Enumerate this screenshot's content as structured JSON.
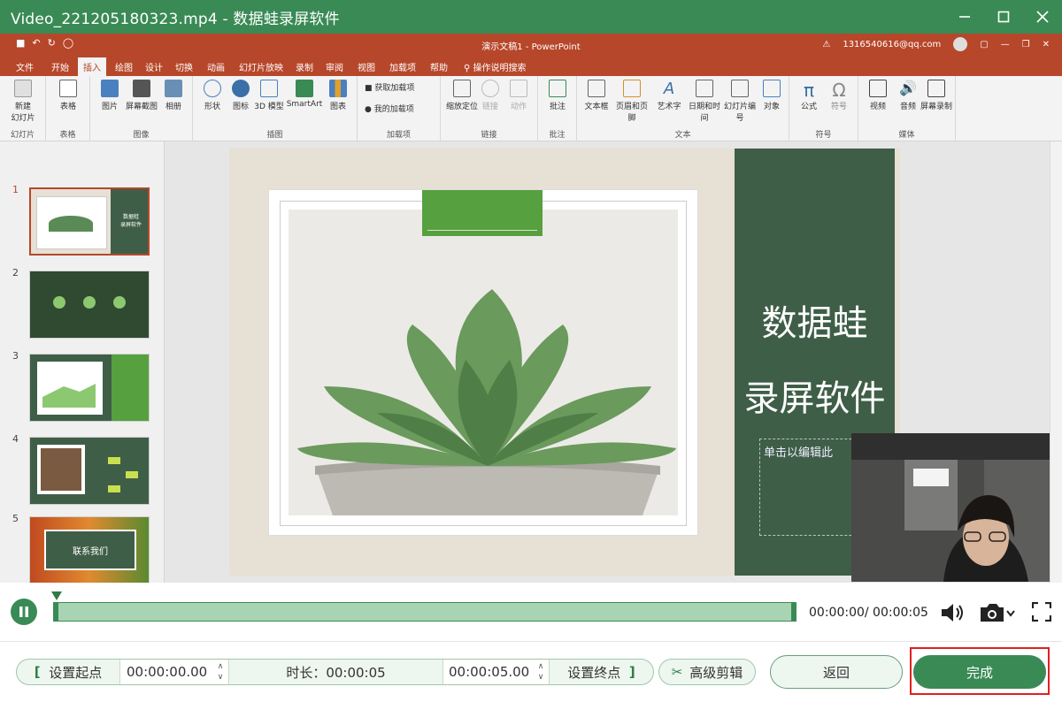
{
  "window": {
    "title": "Video_221205180323.mp4  -  数据蛙录屏软件"
  },
  "ppt": {
    "doc_title": "演示文稿1 - PowerPoint",
    "account": "1316540616@qq.com",
    "tabs": [
      "文件",
      "开始",
      "插入",
      "绘图",
      "设计",
      "切换",
      "动画",
      "幻灯片放映",
      "录制",
      "审阅",
      "视图",
      "加载项",
      "帮助",
      "操作说明搜索"
    ],
    "active_tab": "插入",
    "ribbon_groups": [
      {
        "label": "幻灯片",
        "buttons": [
          "新建\n幻灯片"
        ]
      },
      {
        "label": "表格",
        "buttons": [
          "表格"
        ]
      },
      {
        "label": "图像",
        "buttons": [
          "图片",
          "屏幕截图",
          "相册"
        ]
      },
      {
        "label": "插图",
        "buttons": [
          "形状",
          "图标",
          "3D 模型",
          "SmartArt",
          "图表"
        ]
      },
      {
        "label": "加载项",
        "buttons": [
          "获取加载项",
          "我的加载项"
        ]
      },
      {
        "label": "链接",
        "buttons": [
          "缩放定位",
          "链接",
          "动作"
        ]
      },
      {
        "label": "批注",
        "buttons": [
          "批注"
        ]
      },
      {
        "label": "文本",
        "buttons": [
          "文本框",
          "页眉和页脚",
          "艺术字",
          "日期和时间",
          "幻灯片编号",
          "对象"
        ]
      },
      {
        "label": "符号",
        "buttons": [
          "公式",
          "符号"
        ]
      },
      {
        "label": "媒体",
        "buttons": [
          "视频",
          "音频",
          "屏幕录制"
        ]
      }
    ],
    "slide_numbers": [
      "1",
      "2",
      "3",
      "4",
      "5"
    ],
    "thumb_texts": {
      "s1": "数据蛙\n录屏软件",
      "s5": "联系我们"
    },
    "slide": {
      "title_line1": "数据蛙",
      "title_line2": "录屏软件",
      "placeholder": "单击以编辑此"
    }
  },
  "player": {
    "timecode": "00:00:00/ 00:00:05",
    "progress": 0.0
  },
  "controls": {
    "set_start": "设置起点",
    "start_time": "00:00:00.00",
    "duration": "时长：00:00:05",
    "end_time": "00:00:05.00",
    "set_end": "设置终点",
    "advanced_edit": "高级剪辑",
    "back": "返回",
    "done": "完成"
  },
  "colors": {
    "brand_green": "#3a8a55",
    "ppt_orange": "#b7472a",
    "highlight_red": "#e02020"
  }
}
